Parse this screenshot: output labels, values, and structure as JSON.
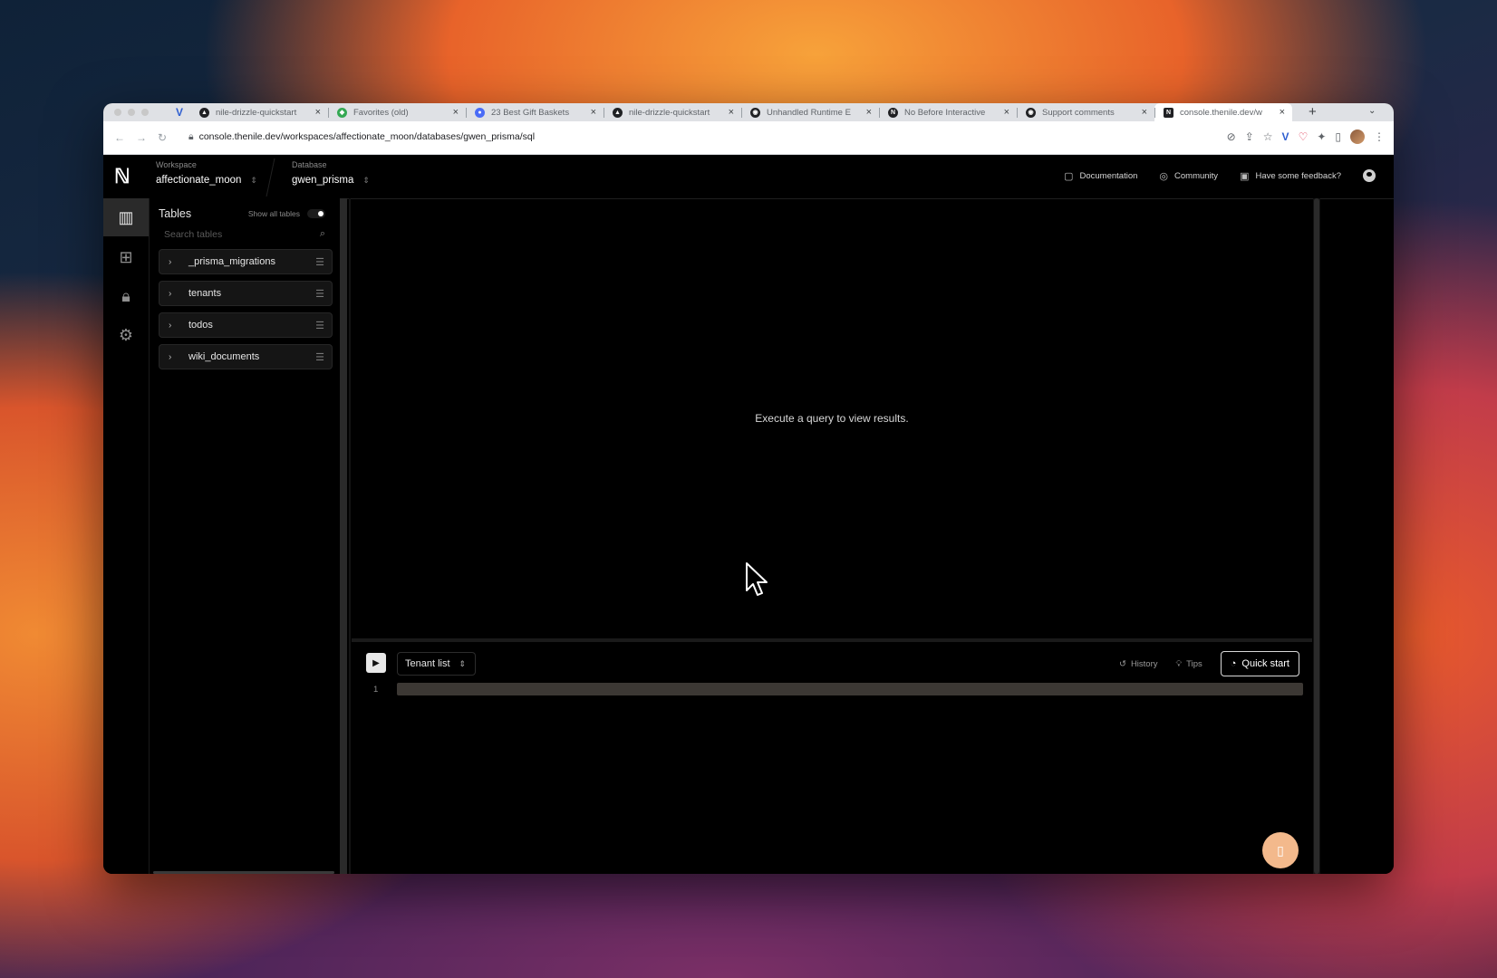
{
  "browser": {
    "tabs": [
      {
        "title": "nile-drizzle-quickstart",
        "favicon_color": "#202124",
        "favicon": "nile-logo-icon"
      },
      {
        "title": "Favorites (old)",
        "favicon_color": "#34a853",
        "favicon": "diamond-icon"
      },
      {
        "title": "23 Best Gift Baskets",
        "favicon_color": "#4a6cf7",
        "favicon": "circle-icon"
      },
      {
        "title": "nile-drizzle-quickstart",
        "favicon_color": "#202124",
        "favicon": "nile-logo-icon"
      },
      {
        "title": "Unhandled Runtime E",
        "favicon_color": "#202124",
        "favicon": "github-icon"
      },
      {
        "title": "No Before Interactive",
        "favicon_color": "#202124",
        "favicon": "next-logo-icon"
      },
      {
        "title": "Support comments",
        "favicon_color": "#202124",
        "favicon": "github-icon"
      },
      {
        "title": "console.thenile.dev/w",
        "favicon_color": "#202124",
        "favicon": "nile-logo-icon"
      }
    ],
    "url": "console.thenile.dev/workspaces/affectionate_moon/databases/gwen_prisma/sql"
  },
  "header": {
    "workspace_label": "Workspace",
    "workspace_value": "affectionate_moon",
    "database_label": "Database",
    "database_value": "gwen_prisma",
    "links": [
      {
        "label": "Documentation",
        "icon": "book-icon"
      },
      {
        "label": "Community",
        "icon": "community-icon"
      },
      {
        "label": "Have some feedback?",
        "icon": "feedback-icon"
      }
    ]
  },
  "tables_panel": {
    "title": "Tables",
    "show_all_label": "Show all tables",
    "search_placeholder": "Search tables",
    "tables": [
      "_prisma_migrations",
      "tenants",
      "todos",
      "wiki_documents"
    ]
  },
  "results": {
    "empty_message": "Execute a query to view results."
  },
  "editor": {
    "query_name": "Tenant list",
    "history_label": "History",
    "tips_label": "Tips",
    "quick_start_label": "Quick start",
    "line_number": "1"
  }
}
